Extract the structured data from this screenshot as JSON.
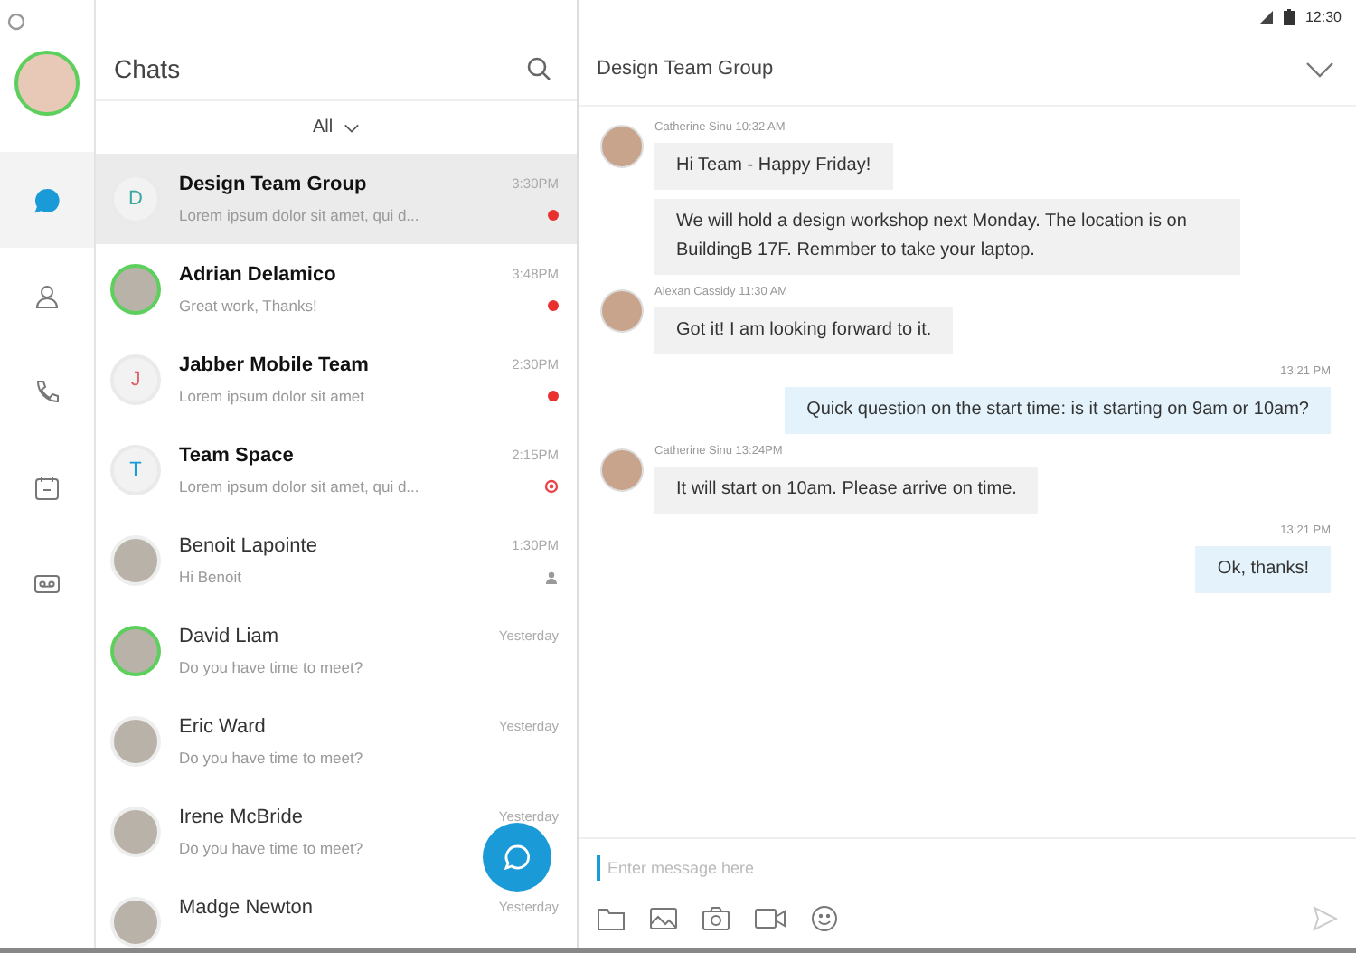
{
  "status_bar": {
    "time": "12:30"
  },
  "rail": {
    "items": [
      {
        "kind": "chat",
        "selected": true
      },
      {
        "kind": "contacts",
        "selected": false
      },
      {
        "kind": "phone",
        "selected": false
      },
      {
        "kind": "calendar",
        "selected": false
      },
      {
        "kind": "voicemail",
        "selected": false
      }
    ]
  },
  "chat_list": {
    "title": "Chats",
    "filter": "All",
    "rows": [
      {
        "name": "Design Team Group",
        "preview": "Lorem ipsum dolor sit amet, qui d...",
        "time": "3:30PM",
        "avatar": {
          "kind": "letter",
          "letter": "D",
          "color": "#3aa8a0"
        },
        "online": false,
        "indicator": {
          "kind": "unread"
        },
        "unread_bold": true,
        "selected": true
      },
      {
        "name": "Adrian Delamico",
        "preview": "Great work, Thanks!",
        "time": "3:48PM",
        "avatar": {
          "kind": "photo"
        },
        "online": true,
        "indicator": {
          "kind": "unread"
        },
        "unread_bold": true,
        "selected": false
      },
      {
        "name": "Jabber Mobile Team",
        "preview": "Lorem ipsum dolor sit amet",
        "time": "2:30PM",
        "avatar": {
          "kind": "letter",
          "letter": "J",
          "color": "#e0606a"
        },
        "online": false,
        "indicator": {
          "kind": "unread"
        },
        "unread_bold": true,
        "selected": false
      },
      {
        "name": "Team Space",
        "preview": "Lorem ipsum dolor sit amet, qui d...",
        "time": "2:15PM",
        "avatar": {
          "kind": "letter",
          "letter": "T",
          "color": "#1a9bd7"
        },
        "online": false,
        "indicator": {
          "kind": "alert"
        },
        "unread_bold": true,
        "selected": false
      },
      {
        "name": "Benoit Lapointe",
        "preview": "Hi Benoit",
        "time": "1:30PM",
        "avatar": {
          "kind": "photo"
        },
        "online": false,
        "indicator": {
          "kind": "read"
        },
        "unread_bold": false,
        "selected": false
      },
      {
        "name": "David Liam",
        "preview": "Do you have time to meet?",
        "time": "Yesterday",
        "avatar": {
          "kind": "photo"
        },
        "online": true,
        "unread_bold": false,
        "selected": false
      },
      {
        "name": "Eric Ward",
        "preview": "Do you have time to meet?",
        "time": "Yesterday",
        "avatar": {
          "kind": "photo"
        },
        "online": false,
        "unread_bold": false,
        "selected": false
      },
      {
        "name": "Irene McBride",
        "preview": "Do you have time to meet?",
        "time": "Yesterday",
        "avatar": {
          "kind": "photo"
        },
        "online": false,
        "unread_bold": false,
        "selected": false
      },
      {
        "name": "Madge Newton",
        "time": "Yesterday",
        "avatar": {
          "kind": "photo"
        },
        "online": false,
        "unread_bold": false,
        "selected": false
      }
    ]
  },
  "conversation": {
    "title": "Design Team Group",
    "groups": [
      {
        "kind": "incoming",
        "meta": "Catherine Sinu 10:32 AM",
        "bubbles": [
          "Hi Team - Happy Friday!",
          "We will hold a design workshop next Monday. The location is on BuildingB 17F. Remmber to take your laptop."
        ]
      },
      {
        "kind": "incoming",
        "meta": "Alexan Cassidy 11:30 AM",
        "bubbles": [
          "Got it! I am looking forward to it."
        ]
      },
      {
        "kind": "outgoing",
        "meta": "13:21 PM",
        "bubbles": [
          "Quick question on the start time: is it starting on 9am or 10am?"
        ]
      },
      {
        "kind": "incoming",
        "meta": "Catherine Sinu 13:24PM",
        "bubbles": [
          "It will start on 10am. Please arrive on time."
        ]
      },
      {
        "kind": "outgoing",
        "meta": "13:21 PM",
        "bubbles": [
          "Ok, thanks!"
        ]
      }
    ],
    "composer": {
      "placeholder": "Enter message here"
    }
  }
}
